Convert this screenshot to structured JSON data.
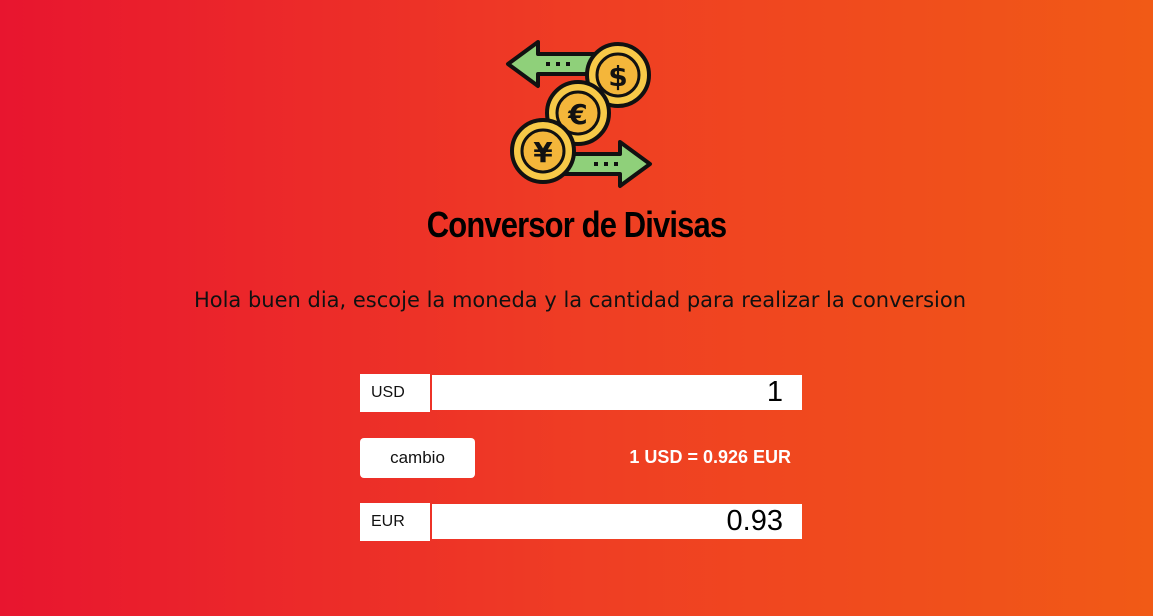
{
  "header": {
    "logo_icon": "currency-exchange-icon",
    "title": "Conversor de Divisas",
    "subtitle": "Hola buen dia, escoje la moneda y la cantidad para realizar la conversion"
  },
  "converter": {
    "from_currency": "USD",
    "from_amount": "1",
    "swap_button_label": "cambio",
    "rate_text": "1 USD = 0.926 EUR",
    "to_currency": "EUR",
    "to_amount": "0.93"
  },
  "colors": {
    "background_start": "#e8152f",
    "background_end": "#f15a16",
    "coin": "#f7c948",
    "arrow": "#8fd07a"
  }
}
